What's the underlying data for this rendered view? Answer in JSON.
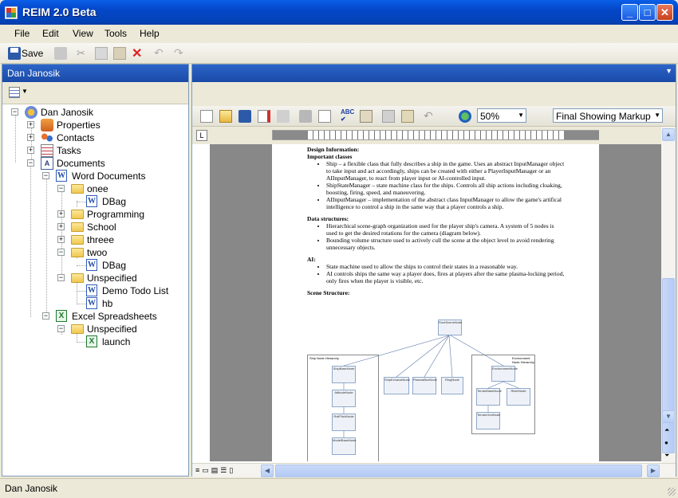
{
  "window": {
    "title": "REIM 2.0 Beta"
  },
  "menu": [
    "File",
    "Edit",
    "View",
    "Tools",
    "Help"
  ],
  "toolbar": {
    "save_label": "Save"
  },
  "left_panel": {
    "header": "Dan Janosik"
  },
  "tree": {
    "root": "Dan Janosik",
    "properties": "Properties",
    "contacts": "Contacts",
    "tasks": "Tasks",
    "documents": "Documents",
    "word_documents": "Word Documents",
    "onee": "onee",
    "dbag1": "DBag",
    "programming": "Programming",
    "school": "School",
    "threee": "threee",
    "twoo": "twoo",
    "dbag2": "DBag",
    "unspecified1": "Unspecified",
    "demo_todo": "Demo Todo List",
    "hb": "hb",
    "excel": "Excel Spreadsheets",
    "unspecified2": "Unspecified",
    "launch": "launch"
  },
  "word_toolbar": {
    "zoom": "50%",
    "markup": "Final Showing Markup"
  },
  "document": {
    "heading1": "Design Information:",
    "heading2": "Important classes",
    "b1": "Ship – a flexible class that fully describes a ship in the game.  Uses an abstract InputManager object to take input and act accordingly, ships can be created with either a PlayerInputManager or an AIInputManager, to react from player input or AI-controlled input.",
    "b2": "ShipStateManager – state machine class for the ships.  Controls all ship actions including cloaking, boosting, firing, speed, and maneuvering.",
    "b3": "AIInputManager – implementation of the abstract class InputManager to allow the game's artifical intelligence to control a ship in the same way that a player controls a ship.",
    "heading3": "Data structures:",
    "b4": "Hierarchical scene-graph organization used for the player ship's camera.  A system of 5 nodes is used to get the desired rotations for the camera (diagram below).",
    "b5": "Bounding volume structure used to actively cull the scene at the object level to avoid rendering unnecessary objects.",
    "heading4": "AI:",
    "b6": "State machine used to allow the ships to control their states in a reasonable way.",
    "b7": "AI controls ships the same way a player does, fires at players after the same plasma-locking period, only fires when the player is visible, etc.",
    "heading5": "Scene Structure:"
  },
  "diagram": {
    "root": "RootSceneNode",
    "ship_group": "Ship Node Hierarchy",
    "env_group": "Environment Node Hierarchy",
    "n1": "ShipBaseNode",
    "n2": "AttitudeNode",
    "n3": "RollPitchNode",
    "n4": "ModelBaseNode",
    "n5": "ShipExhaustNode",
    "n6": "PlasmaBoxNode",
    "n7": "RingNode",
    "n8": "EnvironmentNode",
    "n9": "TerrainBaseNode",
    "n10": "RiderNode",
    "n11": "TerrainGridNode"
  },
  "statusbar": {
    "text": "Dan Janosik"
  },
  "colors": {
    "titlebar": "#0446c8",
    "panel_header": "#1a4aa8",
    "accent": "#316ac5"
  }
}
